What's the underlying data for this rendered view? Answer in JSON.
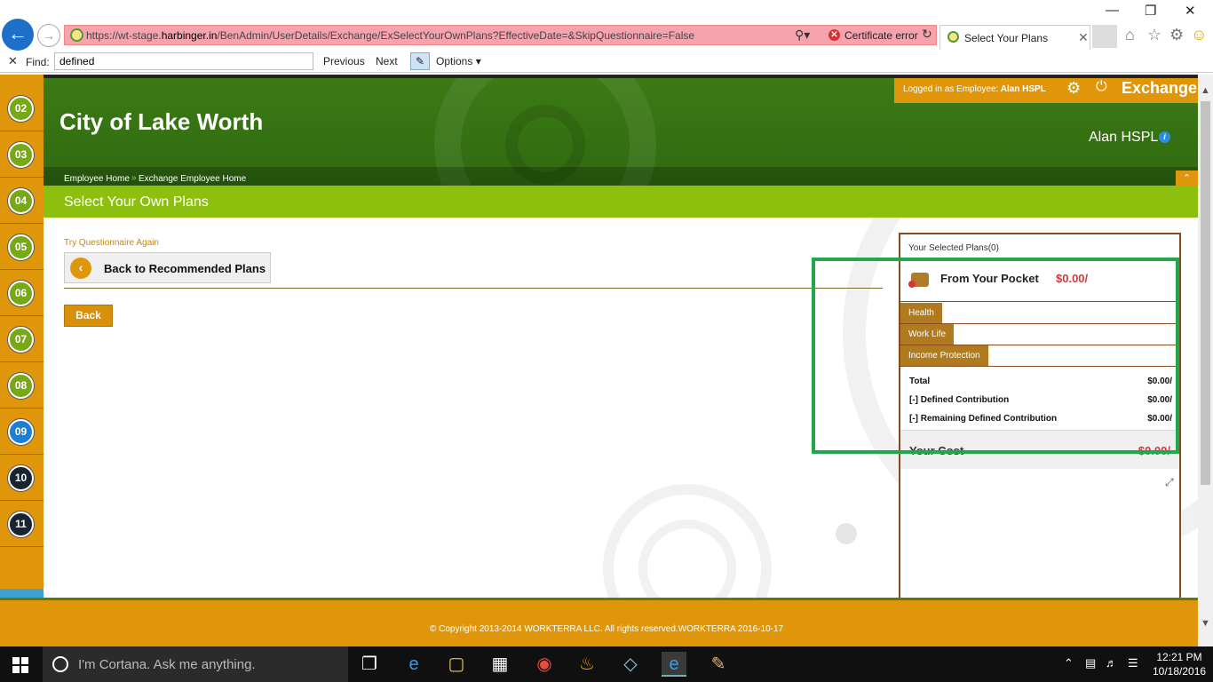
{
  "browser": {
    "url_prefix": "https://wt-stage.",
    "url_domain": "harbinger.in",
    "url_path": "/BenAdmin/UserDetails/Exchange/ExSelectYourOwnPlans?EffectiveDate=&SkipQuestionnaire=False",
    "cert_error": "Certificate error",
    "tab_title": "Select Your Plans"
  },
  "find_bar": {
    "label": "Find:",
    "value": "defined",
    "previous": "Previous",
    "next": "Next",
    "options": "Options"
  },
  "steps": [
    {
      "num": "02",
      "state": "done"
    },
    {
      "num": "03",
      "state": "done"
    },
    {
      "num": "04",
      "state": "done"
    },
    {
      "num": "05",
      "state": "done"
    },
    {
      "num": "06",
      "state": "done"
    },
    {
      "num": "07",
      "state": "done"
    },
    {
      "num": "08",
      "state": "done"
    },
    {
      "num": "09",
      "state": "current"
    },
    {
      "num": "10",
      "state": "todo"
    },
    {
      "num": "11",
      "state": "todo"
    }
  ],
  "header": {
    "org_name": "City of Lake Worth",
    "logged_in_prefix": "Logged in as Employee:",
    "logged_in_user": "Alan HSPL",
    "app_name": "Exchange",
    "user_name": "Alan HSPL",
    "breadcrumbs": [
      "Employee Home",
      "Exchange Employee Home"
    ]
  },
  "page": {
    "title": "Select Your Own Plans",
    "try_questionnaire": "Try Questionnaire Again",
    "back_to_recommended": "Back to Recommended Plans",
    "back": "Back"
  },
  "plans_panel": {
    "heading": "Your Selected Plans(0)",
    "pocket_label": "From Your Pocket",
    "pocket_amount": "$0.00/",
    "categories": [
      "Health",
      "Work Life",
      "Income Protection"
    ],
    "summary": [
      {
        "label": "Total",
        "value": "$0.00/"
      },
      {
        "label": "[-] Defined Contribution",
        "value": "$0.00/"
      },
      {
        "label": "[-] Remaining Defined Contribution",
        "value": "$0.00/"
      }
    ],
    "cost_label": "Your Cost",
    "cost_value": "$0.00/"
  },
  "footer": {
    "copyright": "© Copyright 2013-2014 WORKTERRA LLC. All rights reserved.WORKTERRA 2016-10-17"
  },
  "taskbar": {
    "cortana": "I'm Cortana. Ask me anything.",
    "time": "12:21 PM",
    "date": "10/18/2016"
  },
  "colors": {
    "accent_orange": "#e0960a",
    "header_green": "#3c7a15",
    "title_bar_green": "#8dbf0f",
    "highlight_green": "#21a84c",
    "amount_red": "#d23a3a"
  }
}
